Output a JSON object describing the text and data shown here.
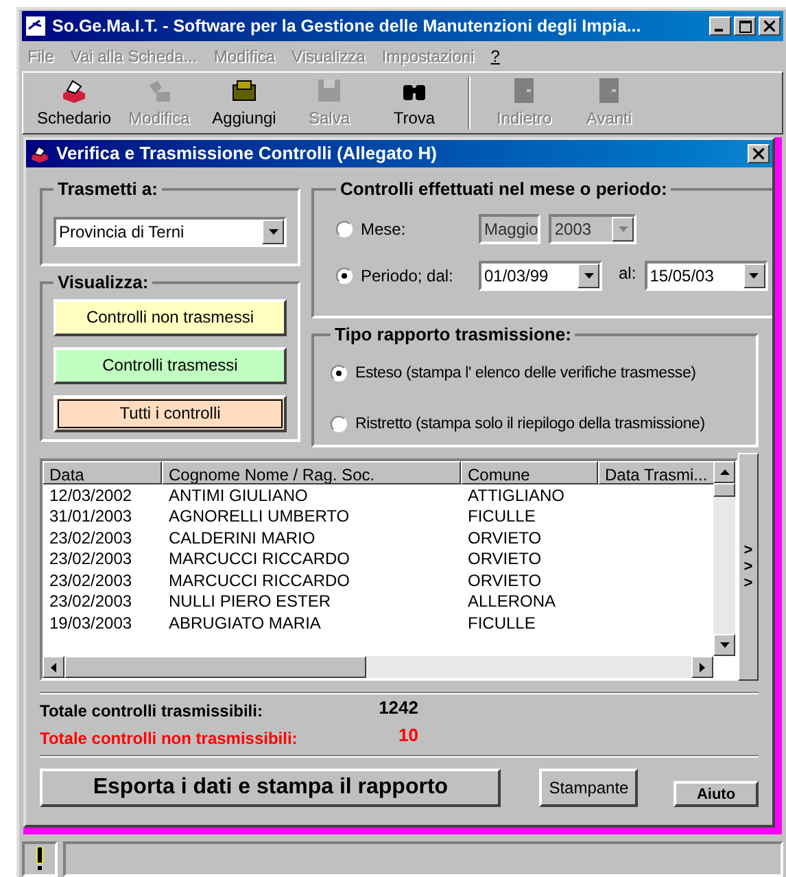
{
  "window": {
    "title": "So.Ge.Ma.I.T. - Software per la Gestione delle Manutenzioni degli Impia..."
  },
  "menu": [
    {
      "label": "File",
      "disabled": true
    },
    {
      "label": "Vai alla Scheda...",
      "disabled": true
    },
    {
      "label": "Modifica",
      "disabled": true
    },
    {
      "label": "Visualizza",
      "disabled": true
    },
    {
      "label": "Impostazioni",
      "disabled": true
    },
    {
      "label": "?",
      "disabled": false
    }
  ],
  "toolbar": [
    {
      "label": "Schedario",
      "kind": "cardfile",
      "disabled": false
    },
    {
      "label": "Modifica",
      "kind": "edit",
      "disabled": true
    },
    {
      "label": "Aggiungi",
      "kind": "add",
      "disabled": false
    },
    {
      "label": "Salva",
      "kind": "save",
      "disabled": true
    },
    {
      "label": "Trova",
      "kind": "find",
      "disabled": false
    },
    {
      "kind": "separator"
    },
    {
      "label": "Indietro",
      "kind": "door",
      "disabled": true
    },
    {
      "label": "Avanti",
      "kind": "door",
      "disabled": true
    }
  ],
  "dialog": {
    "title": "Verifica e Trasmissione Controlli (Allegato H)",
    "trasmetti": {
      "legend": "Trasmetti a:",
      "value": "Provincia di Terni"
    },
    "visualizza": {
      "legend": "Visualizza:",
      "buttons": [
        {
          "label": "Controlli non trasmessi",
          "color": "#ffffc0",
          "selected": false
        },
        {
          "label": "Controlli trasmessi",
          "color": "#c0ffc0",
          "selected": false
        },
        {
          "label": "Tutti i controlli",
          "color": "#ffdcc0",
          "selected": true
        }
      ]
    },
    "periodo": {
      "legend": "Controlli effettuati nel mese o periodo:",
      "options": [
        {
          "label": "Mese:",
          "selected": false,
          "fields": [
            {
              "value": "Maggio",
              "disabled": true
            },
            {
              "value": "2003",
              "disabled": true,
              "dropdown": true
            }
          ]
        },
        {
          "label": "Periodo; dal:",
          "selected": true,
          "fields": [
            {
              "value": "01/03/99",
              "disabled": false,
              "dropdown": true
            },
            {
              "label": "al:",
              "value": "15/05/03",
              "disabled": false,
              "dropdown": true
            }
          ]
        }
      ]
    },
    "tipo": {
      "legend": "Tipo rapporto trasmissione:",
      "options": [
        {
          "label": "Esteso (stampa l' elenco delle verifiche trasmesse)",
          "selected": true
        },
        {
          "label": "Ristretto (stampa solo il riepilogo della trasmissione)",
          "selected": false
        }
      ]
    },
    "table": {
      "columns": [
        "Data",
        "Cognome Nome / Rag. Soc.",
        "Comune",
        "Data Trasmi..."
      ],
      "rows": [
        [
          "12/03/2002",
          "ANTIMI GIULIANO",
          "ATTIGLIANO"
        ],
        [
          "31/01/2003",
          "AGNORELLI UMBERTO",
          "FICULLE"
        ],
        [
          "23/02/2003",
          "CALDERINI MARIO",
          "ORVIETO"
        ],
        [
          "23/02/2003",
          "MARCUCCI RICCARDO",
          "ORVIETO"
        ],
        [
          "23/02/2003",
          "MARCUCCI RICCARDO",
          "ORVIETO"
        ],
        [
          "23/02/2003",
          "NULLI PIERO ESTER",
          "ALLERONA"
        ],
        [
          "19/03/2003",
          "ABRUGIATO MARIA",
          "FICULLE"
        ]
      ]
    },
    "side_arrows": [
      ">",
      ">",
      ">"
    ],
    "totals": [
      {
        "label": "Totale controlli trasmissibili:",
        "value": "1242",
        "kind": "normal"
      },
      {
        "label": "Totale controlli non trasmissibili:",
        "value": "10",
        "kind": "warning"
      }
    ],
    "buttons": [
      {
        "label": "Esporta i dati e stampa il rapporto",
        "kind": "large"
      },
      {
        "label": "Stampante",
        "kind": "normal"
      },
      {
        "label": "Aiuto",
        "kind": "small"
      }
    ]
  }
}
